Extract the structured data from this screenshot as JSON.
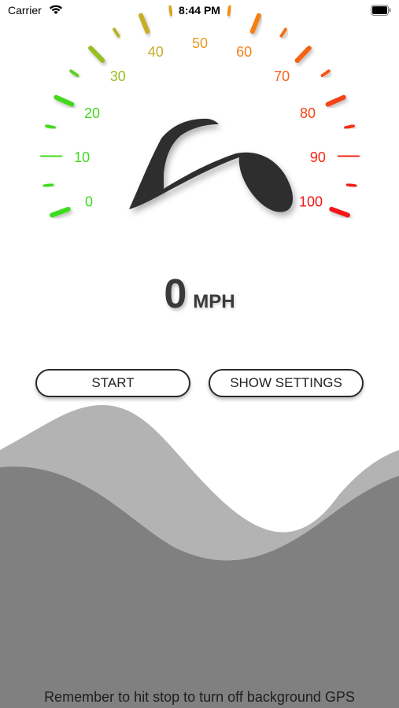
{
  "status_bar": {
    "carrier": "Carrier",
    "time": "8:44 PM"
  },
  "gauge": {
    "labels": [
      "0",
      "10",
      "20",
      "30",
      "40",
      "50",
      "60",
      "70",
      "80",
      "90",
      "100"
    ],
    "needle_value": 0
  },
  "speed": {
    "value": "0",
    "unit": "MPH"
  },
  "buttons": {
    "start": "START",
    "settings": "SHOW SETTINGS"
  },
  "footer": {
    "note": "Remember to hit stop to turn off background GPS"
  }
}
